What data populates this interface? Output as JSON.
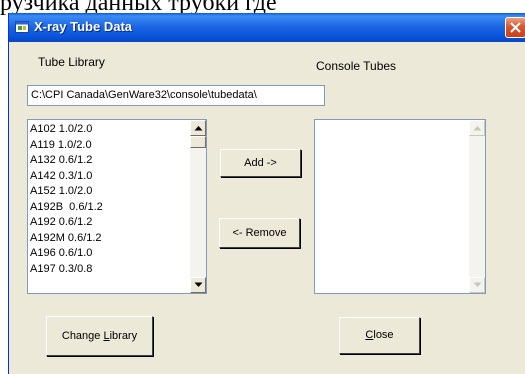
{
  "background_caption": "рузчика данных трубки где",
  "window": {
    "title": "X-ray Tube Data",
    "title_icon": "app-window-icon",
    "close_icon": "close-icon",
    "titlebar_color": "#0a5ad6",
    "close_color": "#d7582f"
  },
  "labels": {
    "tube_library": "Tube Library",
    "console_tubes": "Console Tubes"
  },
  "library_path": {
    "value": "C:\\CPI Canada\\GenWare32\\console\\tubedata\\"
  },
  "tube_library_list": {
    "items": [
      "A102 1.0/2.0",
      "A119 1.0/2.0",
      "A132 0.6/1.2",
      "A142 0.3/1.0",
      "A152 1.0/2.0",
      "A192B  0.6/1.2",
      "A192 0.6/1.2",
      "A192M 0.6/1.2",
      "A196 0.6/1.0",
      "A197 0.3/0.8"
    ]
  },
  "console_tubes_list": {
    "items": []
  },
  "buttons": {
    "add": "Add ->",
    "remove": "<- Remove",
    "change_library_pre": "Change ",
    "change_library_key": "L",
    "change_library_post": "ibrary",
    "close_key": "C",
    "close_post": "lose"
  }
}
